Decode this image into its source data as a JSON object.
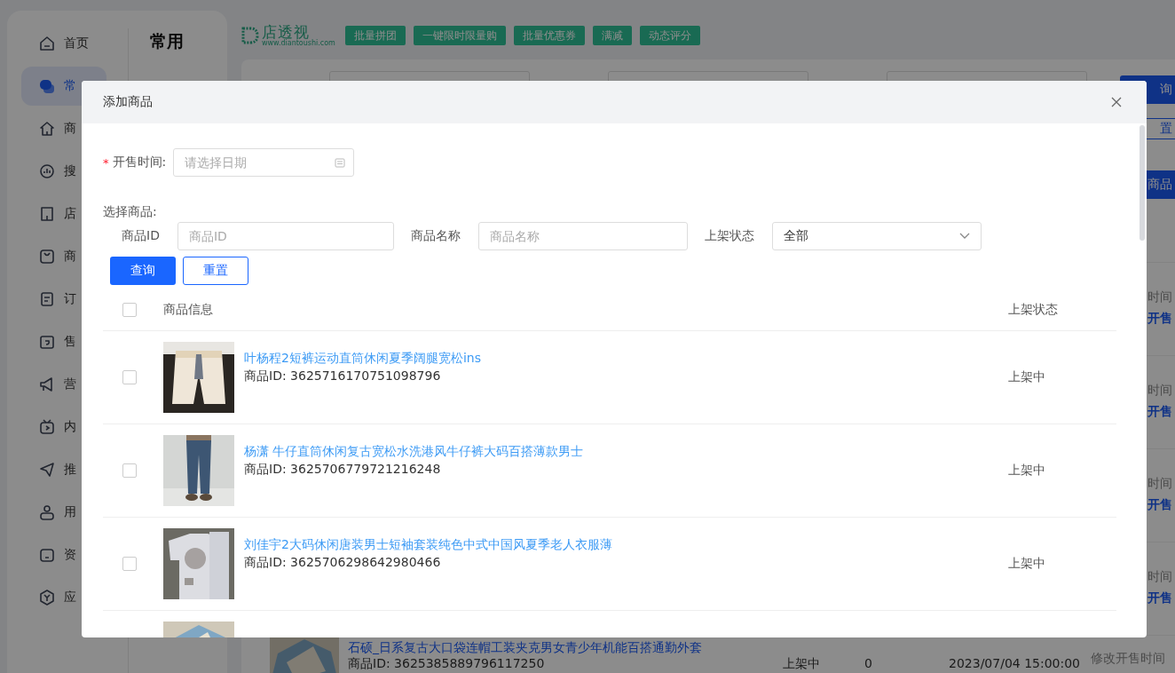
{
  "sidebar": {
    "nav_items": [
      {
        "label": "首页",
        "selected": false
      },
      {
        "label": "常",
        "selected": true
      },
      {
        "label": "商",
        "selected": false
      },
      {
        "label": "搜",
        "selected": false
      },
      {
        "label": "店",
        "selected": false
      },
      {
        "label": "商",
        "selected": false
      },
      {
        "label": "订",
        "selected": false
      },
      {
        "label": "售",
        "selected": false
      },
      {
        "label": "营",
        "selected": false
      },
      {
        "label": "内",
        "selected": false
      },
      {
        "label": "推",
        "selected": false
      },
      {
        "label": "用",
        "selected": false
      },
      {
        "label": "资",
        "selected": false
      },
      {
        "label": "应",
        "selected": false
      }
    ],
    "section_title": "常用"
  },
  "top_bar": {
    "logo": "店透视",
    "logo_url": "www.diantoushi.com",
    "tags": [
      "批量拼团",
      "一键限时限量购",
      "批量优惠券",
      "满减",
      "动态评分"
    ]
  },
  "background": {
    "query_button": "询",
    "reset_button": "置",
    "add_button": "商品",
    "rows": [
      {
        "label": "时间",
        "action": "开售"
      },
      {
        "label": "时间",
        "action": "开售"
      },
      {
        "label": "时间",
        "action": "开售"
      },
      {
        "label": "时间",
        "action": "开售"
      }
    ],
    "product": {
      "title": "石硕_日系复古大口袋连帽工装夹克男女青少年机能百搭通勤外套",
      "product_id": "商品ID: 3625385889796117250",
      "status": "上架中",
      "count": "0",
      "time": "2023/07/04 15:00:00",
      "action": "修改开售时间"
    }
  },
  "dialog": {
    "title": "添加商品",
    "required_mark": "*",
    "date_label": "开售时间:",
    "date_placeholder": "请选择日期",
    "select_label": "选择商品:",
    "filters": [
      {
        "kind": "input",
        "label": "商品ID",
        "placeholder": "商品ID"
      },
      {
        "kind": "input",
        "label": "商品名称",
        "placeholder": "商品名称"
      },
      {
        "kind": "select",
        "label": "上架状态",
        "value": "全部"
      }
    ],
    "query_button": "查询",
    "reset_button": "重置",
    "table": {
      "select_all_checked": false,
      "columns": [
        "商品信息",
        "上架状态"
      ],
      "rows": [
        {
          "kind": "product",
          "checked": false,
          "title": "叶杨程2短裤运动直筒休闲夏季阔腿宽松ins",
          "product_id": "商品ID: 3625716170751098796",
          "status": "上架中"
        },
        {
          "kind": "product",
          "checked": false,
          "title": "杨潇 牛仔直筒休闲复古宽松水洗港风牛仔裤大码百搭薄款男士",
          "product_id": "商品ID: 3625706779721216248",
          "status": "上架中"
        },
        {
          "kind": "product",
          "checked": false,
          "title": "刘佳宇2大码休闲唐装男士短袖套装纯色中式中国风夏季老人衣服薄",
          "product_id": "商品ID: 3625706298642980466",
          "status": "上架中"
        },
        {
          "kind": "picture"
        }
      ]
    }
  }
}
